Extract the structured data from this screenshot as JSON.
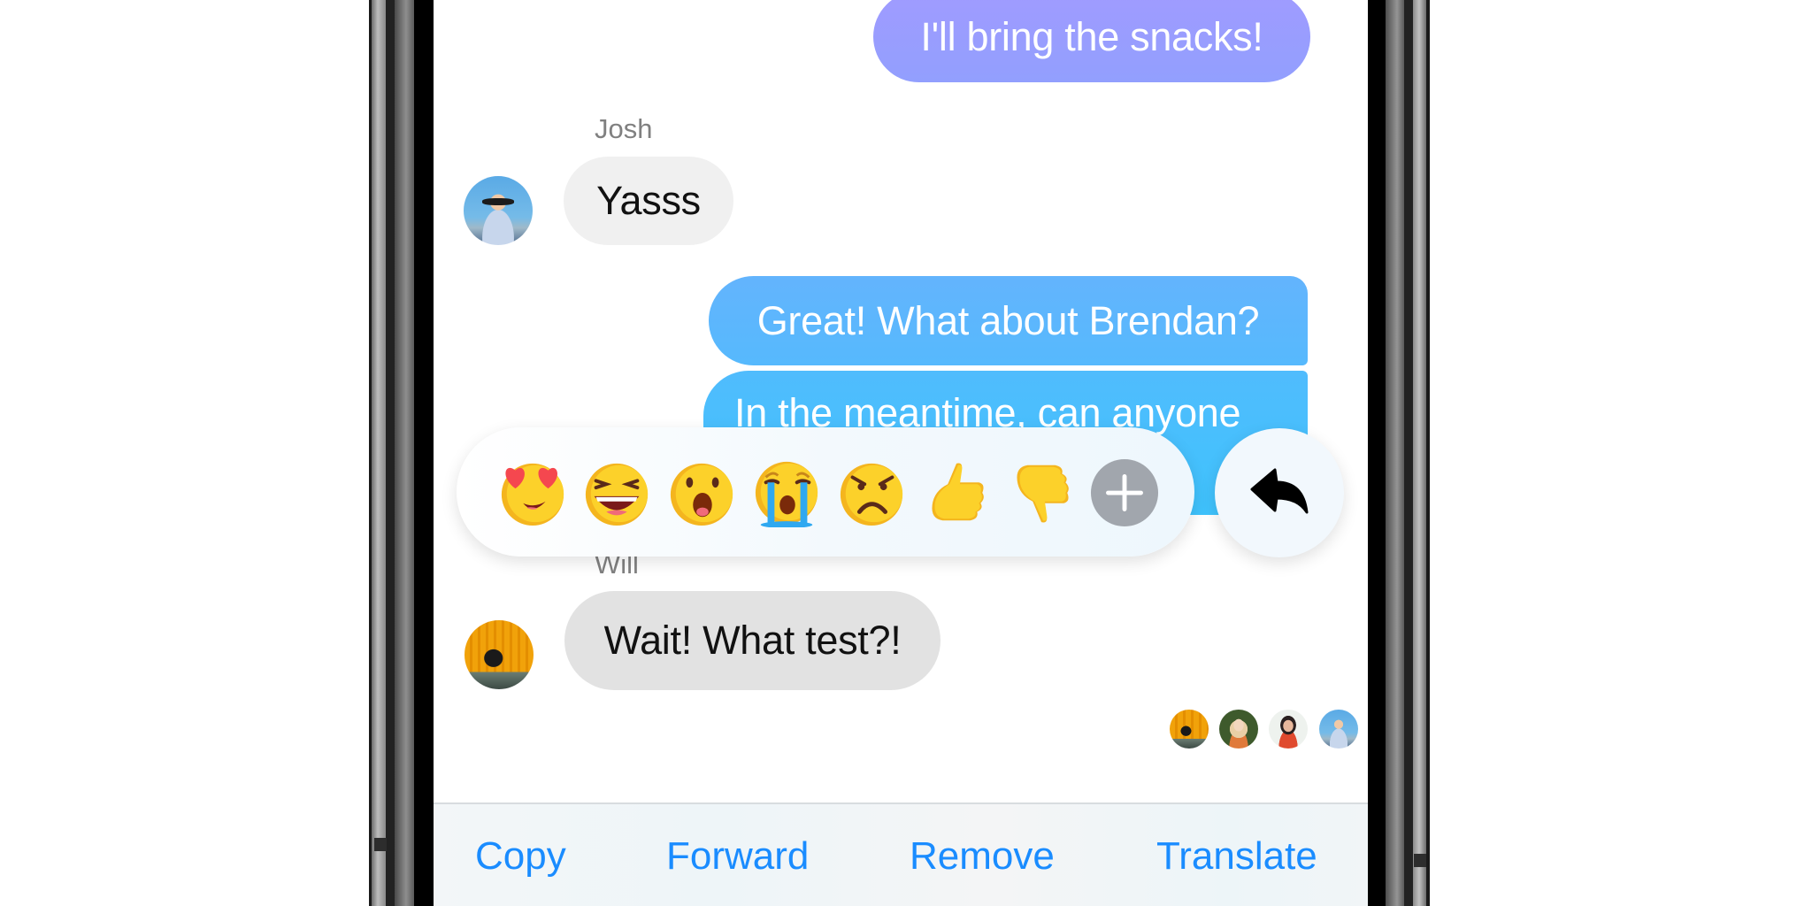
{
  "conversation": {
    "messages": [
      {
        "id": "m1",
        "direction": "outgoing",
        "text": "I'll bring the snacks!",
        "color": "#9c9dff"
      },
      {
        "id": "m2",
        "direction": "incoming",
        "sender": "Josh",
        "text": "Yasss",
        "avatar": "josh-avatar"
      },
      {
        "id": "m3",
        "direction": "outgoing",
        "text": "Great! What about Brendan?",
        "color": "#5db7fd"
      },
      {
        "id": "m4",
        "direction": "outgoing",
        "text": "In the meantime, can anyone",
        "color": "#46c0fd",
        "selected": true
      },
      {
        "id": "m5",
        "direction": "incoming",
        "sender": "Will",
        "text": "Wait! What test?!",
        "avatar": "will-avatar"
      }
    ],
    "read_receipts": [
      "will-avatar",
      "blonde-avatar",
      "brunette-avatar",
      "josh-avatar"
    ]
  },
  "reactions": {
    "items": [
      {
        "name": "heart-eyes",
        "label": "Love"
      },
      {
        "name": "laughing",
        "label": "Haha"
      },
      {
        "name": "wow",
        "label": "Wow"
      },
      {
        "name": "crying",
        "label": "Sad"
      },
      {
        "name": "angry",
        "label": "Angry"
      },
      {
        "name": "thumbs-up",
        "label": "Like"
      },
      {
        "name": "thumbs-down",
        "label": "Dislike"
      },
      {
        "name": "plus",
        "label": "More reactions"
      }
    ],
    "reply_icon": "reply-icon"
  },
  "actions": {
    "copy": "Copy",
    "forward": "Forward",
    "remove": "Remove",
    "translate": "Translate"
  },
  "colors": {
    "accent": "#1a8cff",
    "outgoing_purple": "#9c9dff",
    "outgoing_blue": "#5db7fd",
    "incoming_gray": "#f0f0f0",
    "plus_gray": "#a1a6ad"
  }
}
